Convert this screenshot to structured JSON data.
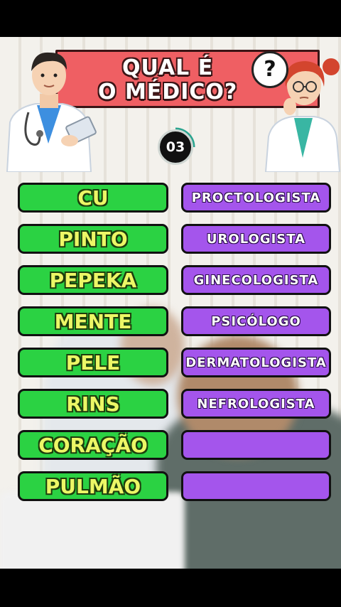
{
  "title": {
    "line1": "QUAL É",
    "line2": "O MÉDICO?"
  },
  "bubble_icon": "question-mark",
  "bubble_text": "?",
  "timer": "03",
  "colors": {
    "banner": "#ef5f63",
    "left_pill": "#2bd243",
    "right_pill": "#a455ec",
    "left_text": "#ecf766"
  },
  "rows": [
    {
      "body_part": "CU",
      "specialist": "PROCTOLOGISTA"
    },
    {
      "body_part": "PINTO",
      "specialist": "UROLOGISTA"
    },
    {
      "body_part": "PEPEKA",
      "specialist": "GINECOLOGISTA"
    },
    {
      "body_part": "MENTE",
      "specialist": "PSICÓLOGO"
    },
    {
      "body_part": "PELE",
      "specialist": "DERMATOLOGISTA"
    },
    {
      "body_part": "RINS",
      "specialist": "NEFROLOGISTA"
    },
    {
      "body_part": "CORAÇÃO",
      "specialist": ""
    },
    {
      "body_part": "PULMÃO",
      "specialist": ""
    }
  ]
}
